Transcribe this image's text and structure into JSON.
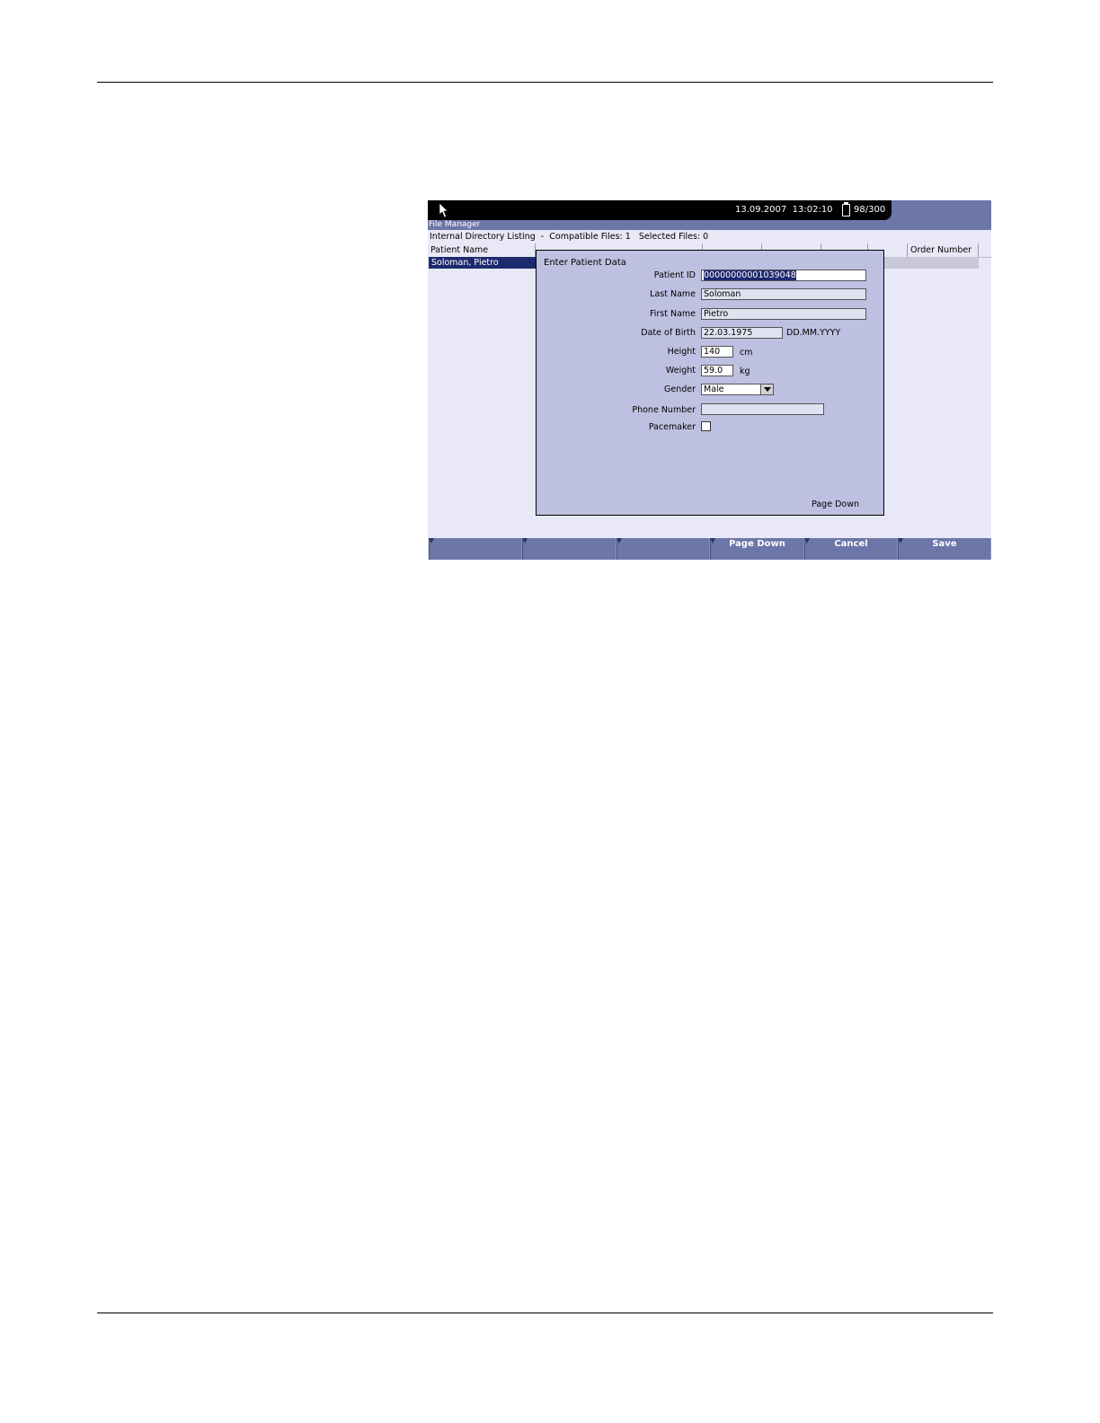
{
  "status": {
    "date": "13.09.2007",
    "time": "13:02:10",
    "storage": "98/300"
  },
  "app_title": "File Manager",
  "directory": {
    "label": "Internal Directory Listing",
    "separator": "-",
    "compatible_files": "Compatible Files: 1",
    "selected_files": "Selected Files: 0"
  },
  "table": {
    "columns": [
      "Patient Name",
      "",
      "",
      "",
      "",
      "",
      "Order Number"
    ],
    "rows": [
      {
        "patient_name": "Soloman, Pietro"
      }
    ]
  },
  "dialog": {
    "title": "Enter Patient Data",
    "fields": {
      "patient_id": {
        "label": "Patient ID",
        "value": "00000000001039048"
      },
      "last_name": {
        "label": "Last Name",
        "value": "Soloman"
      },
      "first_name": {
        "label": "First Name",
        "value": "Pietro"
      },
      "date_of_birth": {
        "label": "Date of Birth",
        "value": "22.03.1975",
        "format": "DD.MM.YYYY"
      },
      "height": {
        "label": "Height",
        "value": "140",
        "unit": "cm"
      },
      "weight": {
        "label": "Weight",
        "value": "59.0",
        "unit": "kg"
      },
      "gender": {
        "label": "Gender",
        "value": "Male"
      },
      "phone_number": {
        "label": "Phone Number",
        "value": ""
      },
      "pacemaker": {
        "label": "Pacemaker",
        "checked": false
      }
    },
    "page_down": "Page Down"
  },
  "softkeys": [
    "",
    "",
    "",
    "Page Down",
    "Cancel",
    "Save"
  ],
  "colors": {
    "accent": "#6d76a8",
    "selection": "#1e2a6e",
    "dialog_bg": "#bdc0e0",
    "screen_bg": "#e8e8f6"
  },
  "icons": [
    "pointer-cursor-icon",
    "battery-icon",
    "dropdown-arrow-icon"
  ]
}
